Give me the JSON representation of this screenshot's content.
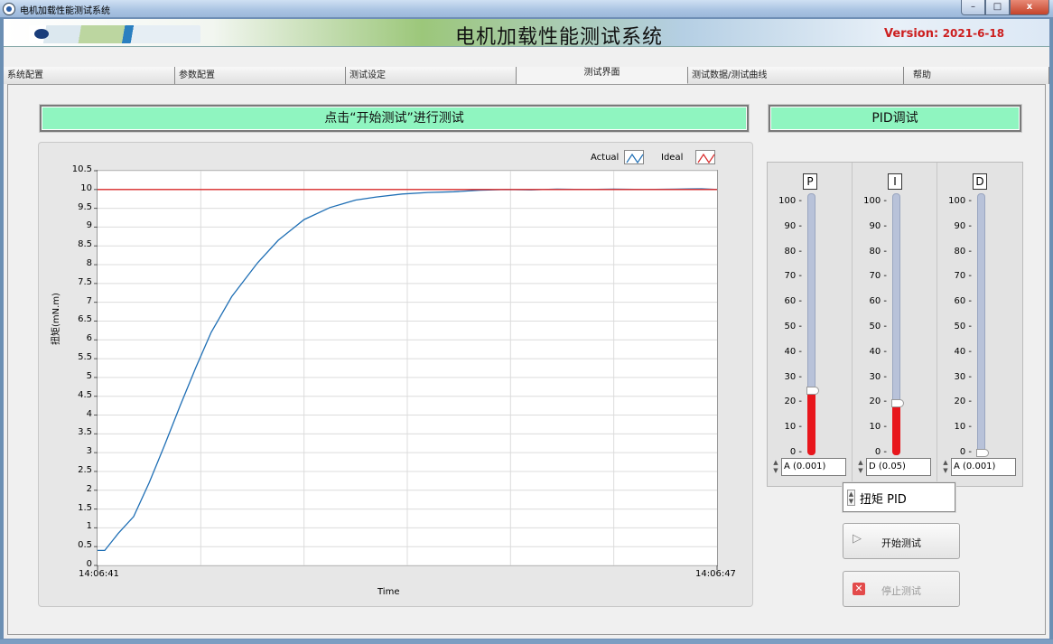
{
  "window": {
    "title": "电机加载性能测试系统",
    "minimize": "–",
    "maximize": "□",
    "close": "x"
  },
  "banner": {
    "title": "电机加载性能测试系统",
    "version_label": "Version:",
    "version_date": "2021-6-18"
  },
  "tabs": [
    {
      "label": "系统配置",
      "active": false
    },
    {
      "label": "参数配置",
      "active": false
    },
    {
      "label": "测试设定",
      "active": false
    },
    {
      "label": "测试界面",
      "active": true
    },
    {
      "label": "测试数据/测试曲线",
      "active": false
    },
    {
      "label": "帮助",
      "active": false
    }
  ],
  "status": {
    "message": "点击“开始测试”进行测试",
    "bg_color": "#8ff5c0"
  },
  "pid": {
    "title": "PID调试",
    "sliders": [
      {
        "letter": "P",
        "value": 25,
        "unit": "A (0.001)"
      },
      {
        "letter": "I",
        "value": 20,
        "unit": "D (0.05)"
      },
      {
        "letter": "D",
        "value": 0,
        "unit": "A (0.001)"
      }
    ],
    "scale_ticks": [
      "100",
      "90",
      "80",
      "70",
      "60",
      "50",
      "40",
      "30",
      "20",
      "10",
      "0"
    ],
    "fill_color": "#e8161c"
  },
  "controls": {
    "mode": "扭矩 PID",
    "start_label": "开始测试",
    "stop_label": "停止测试"
  },
  "chart_data": {
    "type": "line",
    "xlabel": "Time",
    "ylabel": "扭矩(mN.m)",
    "x_start_label": "14:06:41",
    "x_end_label": "14:06:47",
    "xlim": [
      0,
      6
    ],
    "ylim": [
      0,
      10.5
    ],
    "y_ticks": [
      "10.5",
      "10",
      "9.5",
      "9",
      "8.5",
      "8",
      "7.5",
      "7",
      "6.5",
      "6",
      "5.5",
      "5",
      "4.5",
      "4",
      "3.5",
      "3",
      "2.5",
      "2",
      "1.5",
      "1",
      "0.5",
      "0"
    ],
    "grid": true,
    "legend_position": "top-right",
    "series": [
      {
        "name": "Actual",
        "color": "#1f6fb5",
        "x": [
          0,
          0.07,
          0.2,
          0.35,
          0.5,
          0.65,
          0.8,
          0.95,
          1.1,
          1.3,
          1.55,
          1.75,
          2.0,
          2.25,
          2.5,
          2.7,
          2.95,
          3.2,
          3.45,
          3.7,
          3.95,
          4.2,
          4.45,
          4.75,
          5.0,
          5.3,
          5.6,
          5.85,
          6.0
        ],
        "values": [
          0.4,
          0.4,
          0.85,
          1.3,
          2.2,
          3.2,
          4.25,
          5.25,
          6.2,
          7.15,
          8.05,
          8.65,
          9.2,
          9.52,
          9.72,
          9.8,
          9.88,
          9.92,
          9.94,
          9.98,
          10.0,
          9.99,
          10.01,
          10.0,
          10.01,
          10.0,
          10.01,
          10.02,
          10.0
        ]
      },
      {
        "name": "Ideal",
        "color": "#d92a2a",
        "x": [
          0,
          6
        ],
        "values": [
          10,
          10
        ]
      }
    ]
  }
}
